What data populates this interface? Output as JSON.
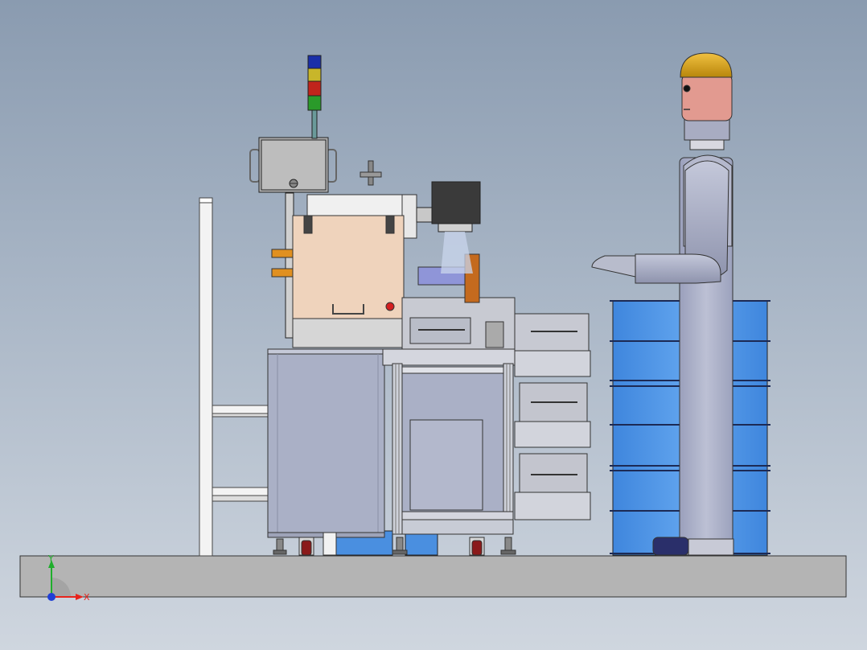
{
  "viewport": {
    "background_top": "#8a9bb0",
    "background_bottom": "#cfd6df"
  },
  "triad": {
    "x_label": "X",
    "y_label": "Y",
    "x_color": "#e8241c",
    "y_color": "#1fae2c",
    "z_color": "#1f3fd6"
  },
  "model": {
    "parts": [
      "floor-slab",
      "side-frame",
      "control-box",
      "signal-tower",
      "main-cabinet",
      "door-frame",
      "upper-module",
      "camera",
      "side-trays",
      "blue-barrels",
      "human-figure"
    ],
    "signal_tower_colors": [
      "#1a2fa8",
      "#c8b62a",
      "#c0241c",
      "#2a9a2a"
    ],
    "colors": {
      "floor": "#b4b4b4",
      "cabinet": "#aab0c6",
      "module": "#efd3bc",
      "barrel": "#4a8fe0",
      "body": "#aab0cc",
      "head": "#e29a90",
      "helmet": "#d9a21e"
    }
  }
}
